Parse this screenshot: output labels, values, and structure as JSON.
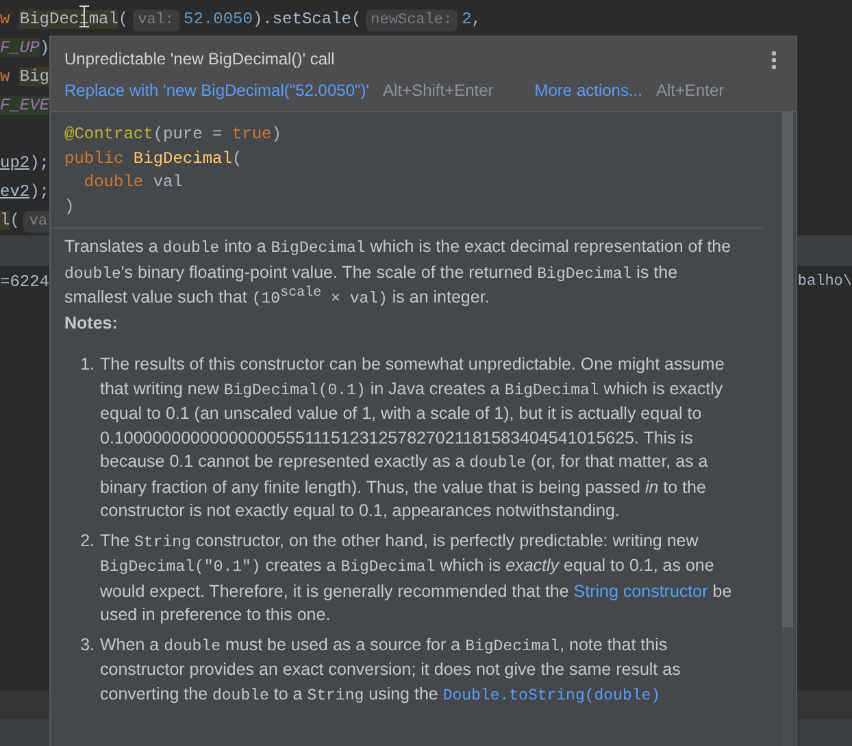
{
  "editor_lines": [
    {
      "kind": "code",
      "tokens": [
        {
          "kind": "keyword",
          "text": "w "
        },
        {
          "kind": "highlight",
          "text": "BigDecimal"
        },
        {
          "kind": "plain",
          "text": "("
        },
        {
          "kind": "hint",
          "text": "val:"
        },
        {
          "kind": "number",
          "text": "52.0050"
        },
        {
          "kind": "plain",
          "text": ").setScale("
        },
        {
          "kind": "hint",
          "text": "newScale:"
        },
        {
          "kind": "number",
          "text": "2"
        },
        {
          "kind": "plain",
          "text": ","
        }
      ]
    },
    {
      "kind": "code",
      "tokens": [
        {
          "kind": "constant",
          "text": "F_UP"
        },
        {
          "kind": "plain",
          "text": ")"
        }
      ]
    },
    {
      "kind": "code",
      "tokens": [
        {
          "kind": "keyword",
          "text": "w "
        },
        {
          "kind": "highlight",
          "text": "Big"
        }
      ]
    },
    {
      "kind": "code",
      "tokens": [
        {
          "kind": "constant",
          "text": "F_EVE"
        }
      ]
    },
    {
      "kind": "blank"
    },
    {
      "kind": "code",
      "tokens": [
        {
          "kind": "underline",
          "text": "up2"
        },
        {
          "kind": "plain",
          "text": ");"
        }
      ]
    },
    {
      "kind": "code",
      "tokens": [
        {
          "kind": "underline",
          "text": "ev2"
        },
        {
          "kind": "plain",
          "text": ");"
        }
      ]
    },
    {
      "kind": "code",
      "tokens": [
        {
          "kind": "highlight",
          "text": "l"
        },
        {
          "kind": "plain",
          "text": "("
        },
        {
          "kind": "hint",
          "text": "va"
        }
      ]
    }
  ],
  "console_lines": [
    {
      "left": "=6224",
      "right": "balho\\"
    }
  ],
  "popup": {
    "title": "Unpredictable 'new BigDecimal()' call",
    "actions": [
      {
        "label": "Replace with 'new BigDecimal(\"52.0050\")'",
        "shortcut": "Alt+Shift+Enter"
      },
      {
        "label": "More actions...",
        "shortcut": "Alt+Enter"
      }
    ],
    "signature": [
      [
        {
          "kind": "annotation",
          "text": "@Contract"
        },
        {
          "kind": "plain",
          "text": "(pure = "
        },
        {
          "kind": "keyword",
          "text": "true"
        },
        {
          "kind": "plain",
          "text": ")"
        }
      ],
      [
        {
          "kind": "keyword",
          "text": "public "
        },
        {
          "kind": "method",
          "text": "BigDecimal"
        },
        {
          "kind": "plain",
          "text": "("
        }
      ],
      [
        {
          "kind": "keyword",
          "text": "  double "
        },
        {
          "kind": "plain",
          "text": "val"
        }
      ],
      [
        {
          "kind": "plain",
          "text": ")"
        }
      ]
    ],
    "description": [
      {
        "kind": "text",
        "text": "Translates a "
      },
      {
        "kind": "code",
        "text": "double"
      },
      {
        "kind": "text",
        "text": " into a "
      },
      {
        "kind": "code",
        "text": "BigDecimal"
      },
      {
        "kind": "text",
        "text": " which is the exact decimal representation of the "
      },
      {
        "kind": "code",
        "text": "double"
      },
      {
        "kind": "text",
        "text": "'s binary floating-point value. The scale of the returned "
      },
      {
        "kind": "code",
        "text": "BigDecimal"
      },
      {
        "kind": "text",
        "text": " is the smallest value such that "
      },
      {
        "kind": "code",
        "text": "(10"
      },
      {
        "kind": "code-sup",
        "text": "scale"
      },
      {
        "kind": "code",
        "text": " × val)"
      },
      {
        "kind": "text",
        "text": " is an integer."
      }
    ],
    "notes_heading": "Notes:",
    "notes": [
      {
        "number": "1.",
        "segments": [
          {
            "kind": "text",
            "text": "The results of this constructor can be somewhat unpredictable. One might assume that writing new "
          },
          {
            "kind": "code",
            "text": "BigDecimal(0.1)"
          },
          {
            "kind": "text",
            "text": " in Java creates a "
          },
          {
            "kind": "code",
            "text": "BigDecimal"
          },
          {
            "kind": "text",
            "text": " which is exactly equal to 0.1 (an unscaled value of 1, with a scale of 1), but it is actually equal to 0.1000000000000000055511151231257827021181583404541015625. This is because 0.1 cannot be represented exactly as a "
          },
          {
            "kind": "code",
            "text": "double"
          },
          {
            "kind": "text",
            "text": " (or, for that matter, as a binary fraction of any finite length). Thus, the value that is being passed "
          },
          {
            "kind": "em",
            "text": "in"
          },
          {
            "kind": "text",
            "text": " to the constructor is not exactly equal to 0.1, appearances notwithstanding."
          }
        ]
      },
      {
        "number": "2.",
        "segments": [
          {
            "kind": "text",
            "text": "The "
          },
          {
            "kind": "code",
            "text": "String"
          },
          {
            "kind": "text",
            "text": " constructor, on the other hand, is perfectly predictable: writing new "
          },
          {
            "kind": "code",
            "text": "BigDecimal(\"0.1\")"
          },
          {
            "kind": "text",
            "text": " creates a "
          },
          {
            "kind": "code",
            "text": "BigDecimal"
          },
          {
            "kind": "text",
            "text": " which is "
          },
          {
            "kind": "em",
            "text": "exactly"
          },
          {
            "kind": "text",
            "text": " equal to 0.1, as one would expect. Therefore, it is generally recommended that the "
          },
          {
            "kind": "link",
            "text": "String constructor"
          },
          {
            "kind": "text",
            "text": " be used in preference to this one."
          }
        ]
      },
      {
        "number": "3.",
        "segments": [
          {
            "kind": "text",
            "text": "When a "
          },
          {
            "kind": "code",
            "text": "double"
          },
          {
            "kind": "text",
            "text": " must be used as a source for a "
          },
          {
            "kind": "code",
            "text": "BigDecimal"
          },
          {
            "kind": "text",
            "text": ", note that this constructor provides an exact conversion; it does not give the same result as converting the "
          },
          {
            "kind": "code",
            "text": "double"
          },
          {
            "kind": "text",
            "text": " to a "
          },
          {
            "kind": "code",
            "text": "String"
          },
          {
            "kind": "text",
            "text": " using the "
          },
          {
            "kind": "code-link",
            "text": "Double.toString(double)"
          }
        ]
      }
    ]
  }
}
